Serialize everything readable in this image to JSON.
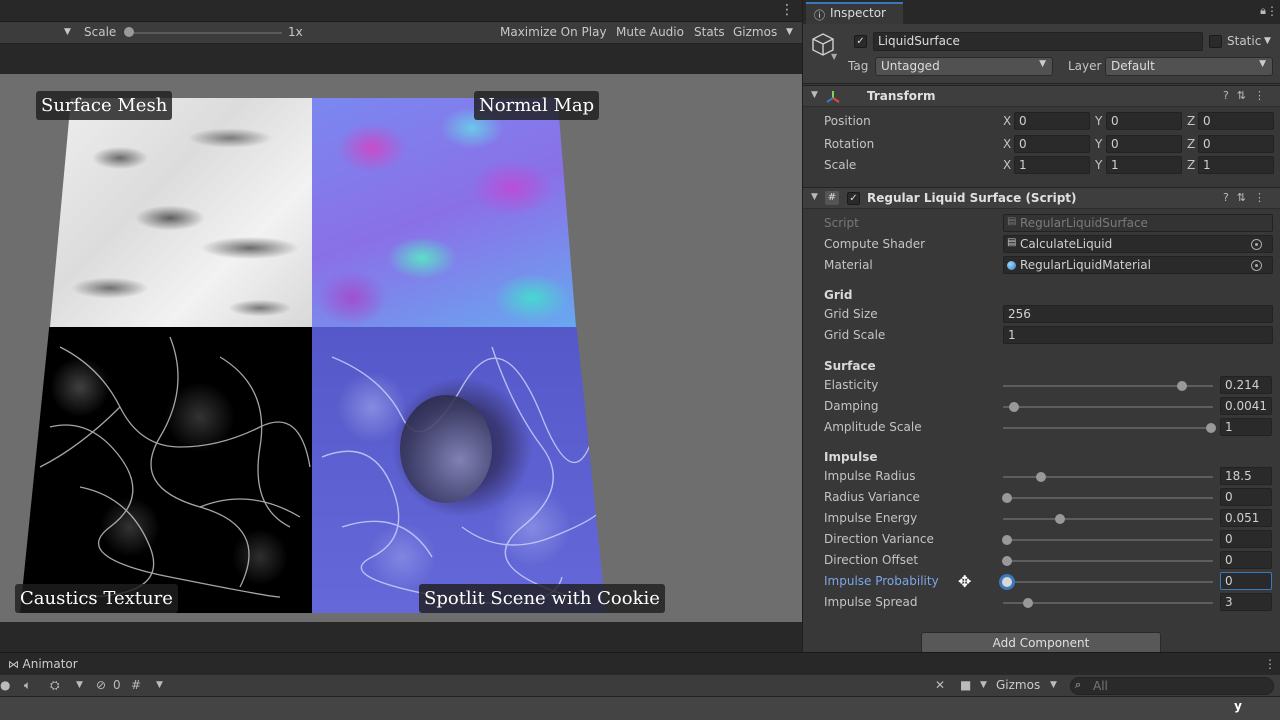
{
  "game": {
    "toolbar": {
      "scale_label": "Scale",
      "scale_value": "1x",
      "maximize_on_play": "Maximize On Play",
      "mute_audio": "Mute Audio",
      "stats": "Stats",
      "gizmos": "Gizmos"
    },
    "labels": {
      "surface_mesh": "Surface Mesh",
      "normal_map": "Normal Map",
      "caustics_texture": "Caustics Texture",
      "spotlit_scene": "Spotlit Scene with Cookie"
    }
  },
  "inspector": {
    "tab_label": "Inspector",
    "gameobject": {
      "name": "LiquidSurface",
      "active": true,
      "static_label": "Static",
      "tag_label": "Tag",
      "tag_value": "Untagged",
      "layer_label": "Layer",
      "layer_value": "Default"
    },
    "transform": {
      "title": "Transform",
      "position": {
        "label": "Position",
        "x": "0",
        "y": "0",
        "z": "0"
      },
      "rotation": {
        "label": "Rotation",
        "x": "0",
        "y": "0",
        "z": "0"
      },
      "scale": {
        "label": "Scale",
        "x": "1",
        "y": "1",
        "z": "1"
      },
      "axis_x": "X",
      "axis_y": "Y",
      "axis_z": "Z"
    },
    "script": {
      "title": "Regular Liquid Surface (Script)",
      "script_label": "Script",
      "script_value": "RegularLiquidSurface",
      "compute_shader_label": "Compute Shader",
      "compute_shader_value": "CalculateLiquid",
      "material_label": "Material",
      "material_value": "RegularLiquidMaterial",
      "grid_section": "Grid",
      "grid_size_label": "Grid Size",
      "grid_size_value": "256",
      "grid_scale_label": "Grid Scale",
      "grid_scale_value": "1",
      "surface_section": "Surface",
      "impulse_section": "Impulse",
      "sliders": [
        {
          "label": "Elasticity",
          "value": "0.214",
          "fill": 0.85
        },
        {
          "label": "Damping",
          "value": "0.0041",
          "fill": 0.05
        },
        {
          "label": "Amplitude Scale",
          "value": "1",
          "fill": 0.99
        },
        {
          "label": "Impulse Radius",
          "value": "18.5",
          "fill": 0.18
        },
        {
          "label": "Radius Variance",
          "value": "0",
          "fill": 0.02
        },
        {
          "label": "Impulse Energy",
          "value": "0.051",
          "fill": 0.27
        },
        {
          "label": "Direction Variance",
          "value": "0",
          "fill": 0.02
        },
        {
          "label": "Direction Offset",
          "value": "0",
          "fill": 0.02
        },
        {
          "label": "Impulse Probability",
          "value": "0",
          "fill": 0.02
        },
        {
          "label": "Impulse Spread",
          "value": "3",
          "fill": 0.12
        }
      ]
    },
    "add_component": "Add Component"
  },
  "animator": {
    "tab_label": "Animator",
    "hidden_count": "0",
    "gizmos": "Gizmos",
    "search_placeholder": "All",
    "axis_label": "y"
  },
  "colors": {
    "accent": "#3a79bb",
    "highlight_label": "#7ca6e8"
  }
}
